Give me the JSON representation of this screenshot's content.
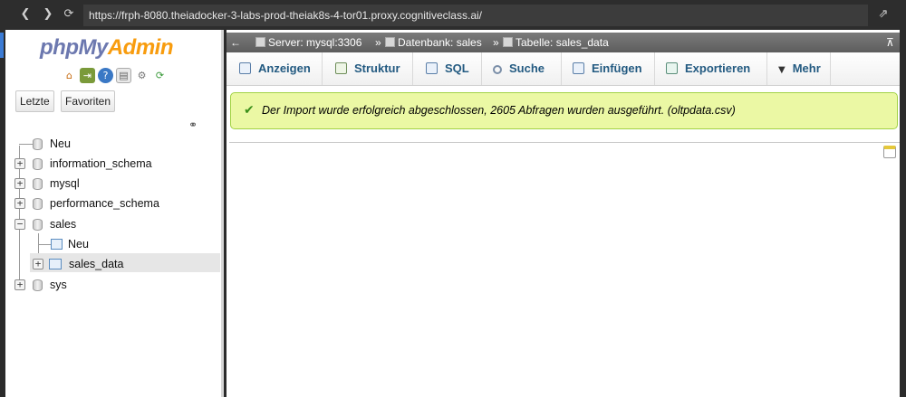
{
  "browser": {
    "url": "https://frph-8080.theiadocker-3-labs-prod-theiak8s-4-tor01.proxy.cognitiveclass.ai/",
    "back_icon": "chevron-left-icon",
    "forward_icon": "chevron-right-icon",
    "reload_icon": "reload-icon",
    "open_external_icon": "external-link-icon"
  },
  "sidebar": {
    "logo": {
      "php": "php",
      "my": "My",
      "admin": "Admin"
    },
    "quick_icons": [
      "home-icon",
      "logout-icon",
      "help-icon",
      "docs-icon",
      "settings-icon",
      "reload-icon"
    ],
    "buttons": {
      "recent": "Letzte",
      "favorites": "Favoriten"
    },
    "link_icon": "link-icon",
    "tree": [
      {
        "label": "Neu",
        "type": "new"
      },
      {
        "label": "information_schema",
        "type": "db"
      },
      {
        "label": "mysql",
        "type": "db"
      },
      {
        "label": "performance_schema",
        "type": "db"
      },
      {
        "label": "sales",
        "type": "db",
        "expanded": true,
        "children": [
          {
            "label": "Neu",
            "type": "new-table"
          },
          {
            "label": "sales_data",
            "type": "table",
            "selected": true
          }
        ]
      },
      {
        "label": "sys",
        "type": "db"
      }
    ]
  },
  "breadcrumb": {
    "server": "Server: mysql:3306",
    "sep1": "»",
    "database": "Datenbank: sales",
    "sep2": "»",
    "table": "Tabelle: sales_data"
  },
  "tabs": [
    {
      "label": "Anzeigen",
      "icon": "browse-icon"
    },
    {
      "label": "Struktur",
      "icon": "structure-icon"
    },
    {
      "label": "SQL",
      "icon": "sql-icon"
    },
    {
      "label": "Suche",
      "icon": "search-icon"
    },
    {
      "label": "Einfügen",
      "icon": "insert-icon"
    },
    {
      "label": "Exportieren",
      "icon": "export-icon"
    },
    {
      "label": "Mehr",
      "icon": "dropdown-icon"
    }
  ],
  "message": {
    "text": "Der Import wurde erfolgreich abgeschlossen, 2605 Abfragen wurden ausgeführt. (oltpdata.csv)",
    "icon": "success-check-icon"
  },
  "colors": {
    "accent": "#235a81",
    "success_bg": "#ebf8a4",
    "success_border": "#a2d246",
    "logo_php": "#6c78af",
    "logo_admin": "#f89c0e"
  }
}
